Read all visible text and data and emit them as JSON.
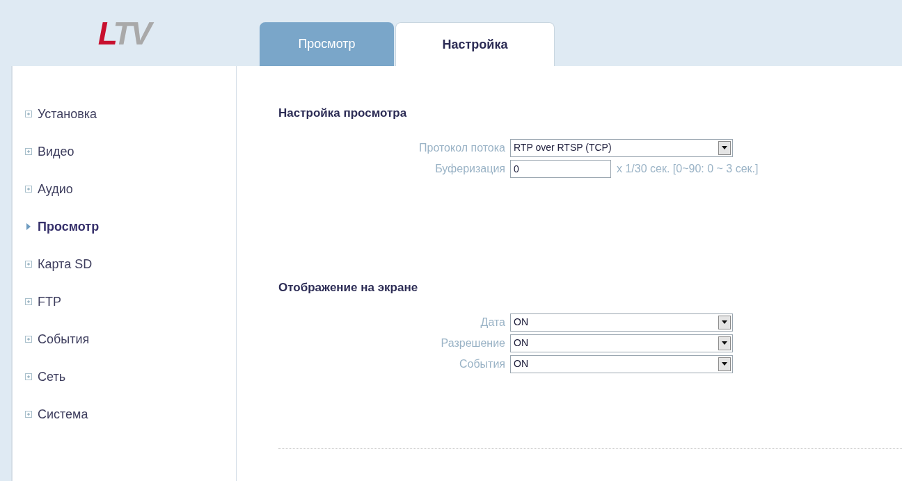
{
  "logo": {
    "text": "LTV"
  },
  "tabs": [
    {
      "label": "Просмотр",
      "selected": false
    },
    {
      "label": "Настройка",
      "selected": true
    }
  ],
  "sidebar": {
    "items": [
      {
        "label": "Установка",
        "selected": false
      },
      {
        "label": "Видео",
        "selected": false
      },
      {
        "label": "Аудио",
        "selected": false
      },
      {
        "label": "Просмотр",
        "selected": true
      },
      {
        "label": "Карта SD",
        "selected": false
      },
      {
        "label": "FTP",
        "selected": false
      },
      {
        "label": "События",
        "selected": false
      },
      {
        "label": "Сеть",
        "selected": false
      },
      {
        "label": "Система",
        "selected": false
      }
    ]
  },
  "sections": [
    {
      "title": "Настройка просмотра",
      "fields": [
        {
          "kind": "select",
          "label": "Протокол потока",
          "value": "RTP over RTSP (TCP)"
        },
        {
          "kind": "text",
          "label": "Буферизация",
          "value": "0",
          "hint": "x 1/30 сек. [0~90: 0 ~ 3 сек.]"
        }
      ]
    },
    {
      "title": "Отображение на экране",
      "fields": [
        {
          "kind": "select",
          "label": "Дата",
          "value": "ON"
        },
        {
          "kind": "select",
          "label": "Разрешение",
          "value": "ON"
        },
        {
          "kind": "select",
          "label": "События",
          "value": "ON"
        }
      ]
    }
  ]
}
